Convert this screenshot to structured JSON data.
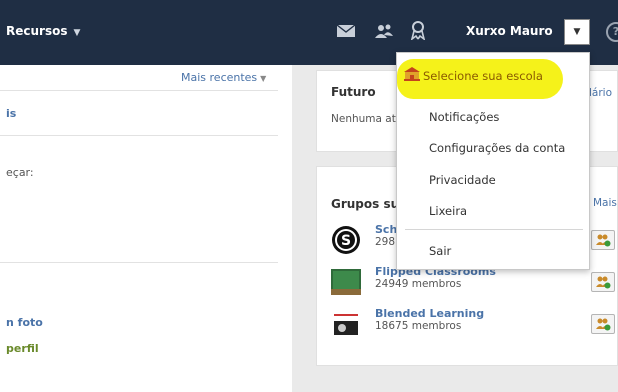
{
  "nav": {
    "recursos_label": "Recursos",
    "username": "Xurxo Mauro",
    "help_glyph": "?"
  },
  "feed": {
    "sort_label": "Mais recentes",
    "text_a": "is",
    "text_b": "eçar:",
    "text_c": "n foto",
    "text_d": "perfil"
  },
  "futuro": {
    "title": "Futuro",
    "text": "Nenhuma at",
    "link_partial": "lário"
  },
  "grupos": {
    "title": "Grupos su",
    "more_partial": "Mais",
    "items": [
      {
        "name": "Sch",
        "members": "298"
      },
      {
        "name": "Flipped Classrooms",
        "members": "24949 membros"
      },
      {
        "name": "Blended Learning",
        "members": "18675 membros"
      }
    ]
  },
  "dropdown": {
    "items": [
      "Selecione sua escola",
      "Notificações",
      "Configurações da conta",
      "Privacidade",
      "Lixeira",
      "Sair"
    ]
  },
  "colors": {
    "nav_bg": "#1f2e44",
    "highlight": "#f5f21a",
    "link": "#4a73a8"
  }
}
